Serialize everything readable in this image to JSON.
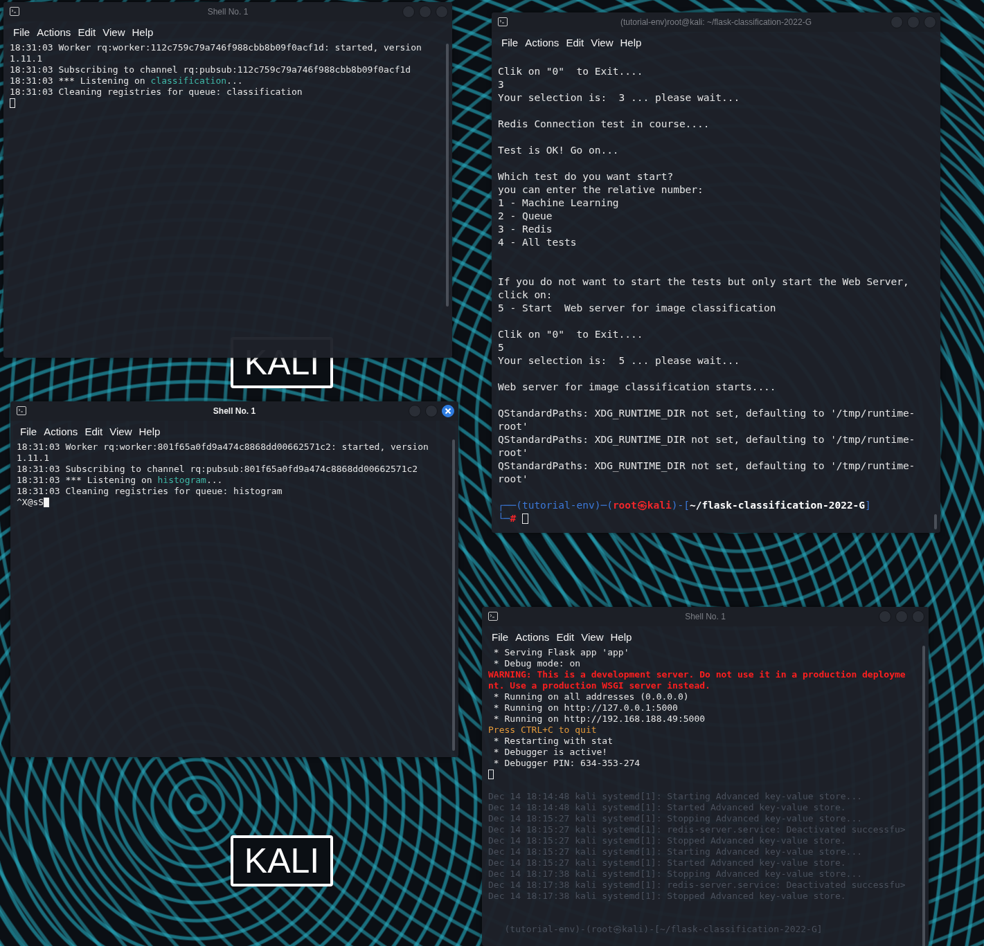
{
  "desktop": {
    "logos": [
      "KALI",
      "KALI"
    ]
  },
  "windows": [
    {
      "title": "Shell No. 1",
      "active": false,
      "menu": [
        "File",
        "Actions",
        "Edit",
        "View",
        "Help"
      ],
      "lines": [
        {
          "kind": "text",
          "text": "18:31:03 Worker rq:worker:112c759c79a746f988cbb8b09f0acf1d: started, version"
        },
        {
          "kind": "text",
          "text": "1.11.1"
        },
        {
          "kind": "text",
          "text": "18:31:03 Subscribing to channel rq:pubsub:112c759c79a746f988cbb8b09f0acf1d"
        },
        {
          "kind": "text",
          "parts": [
            {
              "text": "18:31:03 *** Listening on ",
              "kind": "normal"
            },
            {
              "text": "classification",
              "kind": "queue"
            },
            {
              "text": "...",
              "kind": "normal"
            }
          ]
        },
        {
          "kind": "text",
          "text": "18:31:03 Cleaning registries for queue: classification"
        },
        {
          "kind": "cursor"
        }
      ]
    },
    {
      "title": "(tutorial-env)root@kali: ~/flask-classification-2022-G",
      "active": false,
      "menu": [
        "File",
        "Actions",
        "Edit",
        "View",
        "Help"
      ],
      "lines": [
        {
          "kind": "text",
          "text": "Clik on \"0\"  to Exit...."
        },
        {
          "kind": "text",
          "text": "3"
        },
        {
          "kind": "text",
          "text": "Your selection is:  3 ... please wait..."
        },
        {
          "kind": "blank"
        },
        {
          "kind": "text",
          "text": "Redis Connection test in course...."
        },
        {
          "kind": "blank"
        },
        {
          "kind": "text",
          "text": "Test is OK! Go on..."
        },
        {
          "kind": "blank"
        },
        {
          "kind": "text",
          "text": "Which test do you want start?"
        },
        {
          "kind": "text",
          "text": "you can enter the relative number:"
        },
        {
          "kind": "text",
          "text": "1 - Machine Learning"
        },
        {
          "kind": "text",
          "text": "2 - Queue"
        },
        {
          "kind": "text",
          "text": "3 - Redis"
        },
        {
          "kind": "text",
          "text": "4 - All tests"
        },
        {
          "kind": "blank"
        },
        {
          "kind": "blank"
        },
        {
          "kind": "text",
          "text": "If you do not want to start the tests but only start the Web Server,"
        },
        {
          "kind": "text",
          "text": "click on:"
        },
        {
          "kind": "text",
          "text": "5 - Start  Web server for image classification"
        },
        {
          "kind": "blank"
        },
        {
          "kind": "text",
          "text": "Clik on \"0\"  to Exit...."
        },
        {
          "kind": "text",
          "text": "5"
        },
        {
          "kind": "text",
          "text": "Your selection is:  5 ... please wait..."
        },
        {
          "kind": "blank"
        },
        {
          "kind": "text",
          "text": "Web server for image classification starts...."
        },
        {
          "kind": "blank"
        },
        {
          "kind": "text",
          "text": "QStandardPaths: XDG_RUNTIME_DIR not set, defaulting to '/tmp/runtime-"
        },
        {
          "kind": "text",
          "text": "root'"
        },
        {
          "kind": "text",
          "text": "QStandardPaths: XDG_RUNTIME_DIR not set, defaulting to '/tmp/runtime-"
        },
        {
          "kind": "text",
          "text": "root'"
        },
        {
          "kind": "text",
          "text": "QStandardPaths: XDG_RUNTIME_DIR not set, defaulting to '/tmp/runtime-"
        },
        {
          "kind": "text",
          "text": "root'"
        },
        {
          "kind": "blank"
        },
        {
          "kind": "text",
          "parts": [
            {
              "text": "┌──(tutorial-env)─(",
              "kind": "frame"
            },
            {
              "text": "root㉿kali",
              "kind": "user"
            },
            {
              "text": ")-[",
              "kind": "frame"
            },
            {
              "text": "~/flask-classification-2022-G",
              "kind": "path"
            },
            {
              "text": "]",
              "kind": "frame"
            }
          ]
        },
        {
          "kind": "cursor",
          "parts": [
            {
              "text": "└─",
              "kind": "frame"
            },
            {
              "text": "# ",
              "kind": "user"
            }
          ]
        }
      ]
    },
    {
      "title": "Shell No. 1",
      "active": true,
      "menu": [
        "File",
        "Actions",
        "Edit",
        "View",
        "Help"
      ],
      "lines": [
        {
          "kind": "text",
          "text": "18:31:03 Worker rq:worker:801f65a0fd9a474c8868dd00662571c2: started, version"
        },
        {
          "kind": "text",
          "text": "1.11.1"
        },
        {
          "kind": "text",
          "text": "18:31:03 Subscribing to channel rq:pubsub:801f65a0fd9a474c8868dd00662571c2"
        },
        {
          "kind": "text",
          "parts": [
            {
              "text": "18:31:03 *** Listening on ",
              "kind": "normal"
            },
            {
              "text": "histogram",
              "kind": "queue"
            },
            {
              "text": "...",
              "kind": "normal"
            }
          ]
        },
        {
          "kind": "text",
          "text": "18:31:03 Cleaning registries for queue: histogram"
        },
        {
          "kind": "cursor",
          "text": "^X@sS"
        }
      ]
    },
    {
      "title": "Shell No. 1",
      "active": false,
      "menu": [
        "File",
        "Actions",
        "Edit",
        "View",
        "Help"
      ],
      "lines": [
        {
          "kind": "text",
          "text": " * Serving Flask app 'app'"
        },
        {
          "kind": "text",
          "text": " * Debug mode: on"
        },
        {
          "kind": "warning",
          "text": "WARNING: This is a development server. Do not use it in a production deployme"
        },
        {
          "kind": "warning",
          "text": "nt. Use a production WSGI server instead."
        },
        {
          "kind": "text",
          "text": " * Running on all addresses (0.0.0.0)"
        },
        {
          "kind": "text",
          "text": " * Running on http://127.0.0.1:5000"
        },
        {
          "kind": "text",
          "text": " * Running on http://192.168.188.49:5000"
        },
        {
          "kind": "notice",
          "text": "Press CTRL+C to quit"
        },
        {
          "kind": "text",
          "text": " * Restarting with stat"
        },
        {
          "kind": "text",
          "text": " * Debugger is active!"
        },
        {
          "kind": "text",
          "text": " * Debugger PIN: 634-353-274"
        },
        {
          "kind": "cursor"
        },
        {
          "kind": "blank"
        },
        {
          "kind": "ghost",
          "text": "Dec 14 18:14:48 kali systemd[1]: Starting Advanced key-value store..."
        },
        {
          "kind": "ghost",
          "text": "Dec 14 18:14:48 kali systemd[1]: Started Advanced key-value store."
        },
        {
          "kind": "ghost",
          "text": "Dec 14 18:15:27 kali systemd[1]: Stopping Advanced key-value store..."
        },
        {
          "kind": "ghost",
          "text": "Dec 14 18:15:27 kali systemd[1]: redis-server.service: Deactivated successfu>"
        },
        {
          "kind": "ghost",
          "text": "Dec 14 18:15:27 kali systemd[1]: Stopped Advanced key-value store."
        },
        {
          "kind": "ghost",
          "text": "Dec 14 18:15:27 kali systemd[1]: Starting Advanced key-value store..."
        },
        {
          "kind": "ghost",
          "text": "Dec 14 18:15:27 kali systemd[1]: Started Advanced key-value store."
        },
        {
          "kind": "ghost",
          "text": "Dec 14 18:17:38 kali systemd[1]: Stopping Advanced key-value store..."
        },
        {
          "kind": "ghost",
          "text": "Dec 14 18:17:38 kali systemd[1]: redis-server.service: Deactivated successfu>"
        },
        {
          "kind": "ghost",
          "text": "Dec 14 18:17:38 kali systemd[1]: Stopped Advanced key-value store."
        },
        {
          "kind": "blank"
        },
        {
          "kind": "blank"
        },
        {
          "kind": "ghost",
          "text": "   (tutorial-env)-(root㉿kali)-[~/flask-classification-2022-G]"
        }
      ]
    }
  ]
}
